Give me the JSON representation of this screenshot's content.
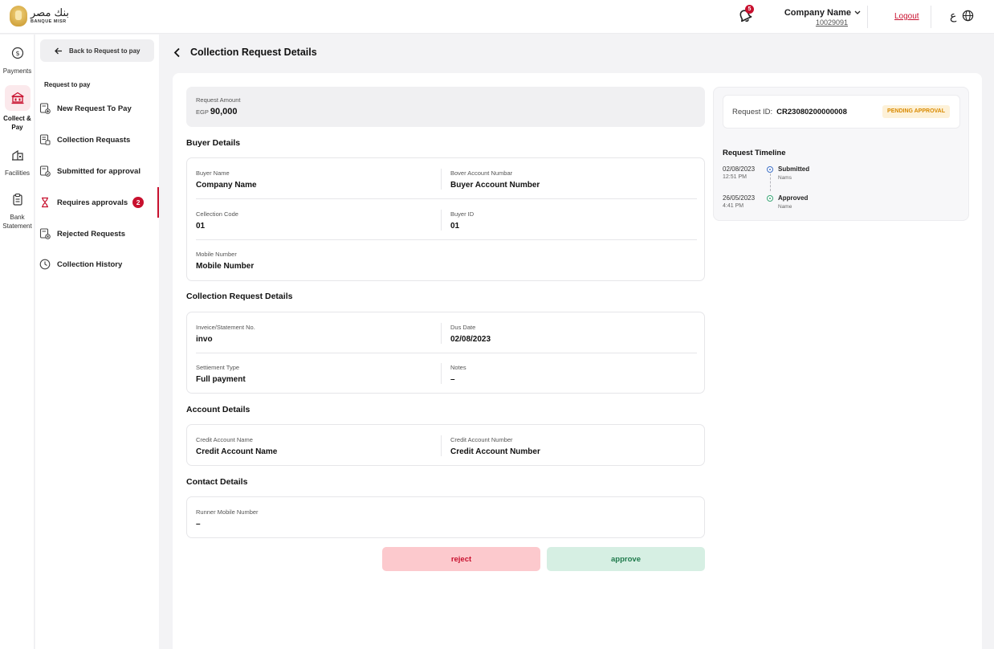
{
  "header": {
    "logo_ar": "بنك مصر",
    "logo_en": "BANQUE MISR",
    "notification_count": "5",
    "company_name": "Company Name",
    "company_id": "10029091",
    "logout": "Logout",
    "lang_toggle": "ع"
  },
  "rail": {
    "items": [
      {
        "label": "Payments",
        "icon": "dollar-coin-icon"
      },
      {
        "label": "Collect & Pay",
        "icon": "bank-icon"
      },
      {
        "label": "Facilities",
        "icon": "building-icon"
      },
      {
        "label": "Bank Statement",
        "icon": "clipboard-icon"
      }
    ]
  },
  "subnav": {
    "back_label": "Back to Request to pay",
    "heading": "Request to pay",
    "items": [
      {
        "label": "New Request To Pay"
      },
      {
        "label": "Collection Requasts"
      },
      {
        "label": "Submitted for approval"
      },
      {
        "label": "Requires approvals",
        "count": "2"
      },
      {
        "label": "Rejected Requests"
      },
      {
        "label": "Collection History"
      }
    ]
  },
  "page": {
    "title": "Collection Request Details"
  },
  "amount": {
    "label": "Request Amount",
    "currency": "EGP",
    "value": "90,000"
  },
  "buyer": {
    "title": "Buyer Details",
    "buyer_name_label": "Buyer Name",
    "buyer_name": "Company Name",
    "buyer_account_label": "Bover Account Numbar",
    "buyer_account": "Buyer Account Number",
    "collection_code_label": "Cellection Code",
    "collection_code": "01",
    "buyer_id_label": "Buyer ID",
    "buyer_id": "01",
    "mobile_label": "Mobile Number",
    "mobile": "Mobile Number"
  },
  "collection": {
    "title": "Collection Request Details",
    "invoice_label": "Inveice/Statement No.",
    "invoice": "invo",
    "due_label": "Dus Date",
    "due": "02/08/2023",
    "settlement_label": "Settiement Type",
    "settlement": "Full payment",
    "notes_label": "Notes",
    "notes": "–"
  },
  "account": {
    "title": "Account Details",
    "credit_name_label": "Credit Account Name",
    "credit_name": "Credit Account Name",
    "credit_number_label": "Credit Account Number",
    "credit_number": "Credit Account Number"
  },
  "contact": {
    "title": "Contact Details",
    "runner_label": "Runner Mobile Number",
    "runner": "–"
  },
  "actions": {
    "reject": "reject",
    "approve": "approve"
  },
  "request": {
    "id_label": "Request ID:",
    "id": "CR23080200000008",
    "status": "PENDING APPROVAL",
    "timeline_title": "Request Timeline",
    "timeline": [
      {
        "date": "02/08/2023",
        "time": "12:51 PM",
        "status": "Submitted",
        "name": "Nams"
      },
      {
        "date": "26/05/2023",
        "time": "4:41 PM",
        "status": "Approved",
        "name": "Name"
      }
    ]
  },
  "colors": {
    "brand_red": "#c8102e",
    "reject_bg": "#fcc9cd",
    "approve_bg": "#d6efe3",
    "pending_bg": "#fdf1d8"
  }
}
